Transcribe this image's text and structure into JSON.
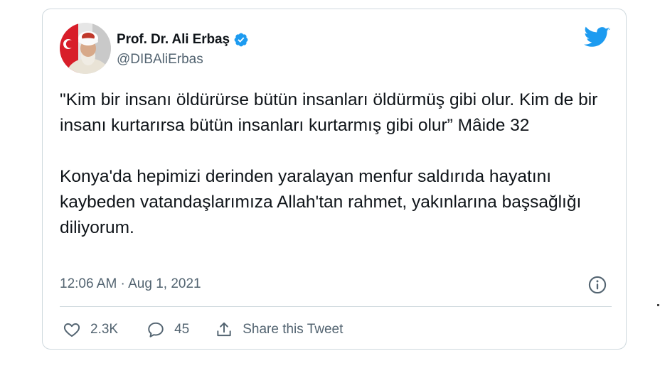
{
  "tweet": {
    "author": {
      "name": "Prof. Dr. Ali Erbaş",
      "handle": "@DIBAliErbas",
      "verified": true
    },
    "text_paragraphs": [
      "\"Kim bir insanı öldürürse bütün insanları öldürmüş gibi olur. Kim de bir insanı kurtarırsa bütün insanları kurtarmış gibi olur” Mâide 32",
      "Konya'da hepimizi derinden yaralayan menfur saldırıda hayatını kaybeden vatandaşlarımıza Allah'tan rahmet, yakınlarına başsağlığı diliyorum."
    ],
    "timestamp": "12:06 AM · Aug 1, 2021",
    "actions": {
      "likes": "2.3K",
      "replies": "45",
      "share_label": "Share this Tweet"
    }
  },
  "icons": {
    "brand": "twitter-bird-icon",
    "verified": "verified-badge-icon",
    "info": "info-icon",
    "like": "heart-icon",
    "reply": "speech-bubble-icon",
    "share": "share-upload-icon"
  },
  "colors": {
    "twitter_blue": "#1d9bf0",
    "text_primary": "#0f1419",
    "text_secondary": "#536471",
    "border": "#cfd9de"
  }
}
